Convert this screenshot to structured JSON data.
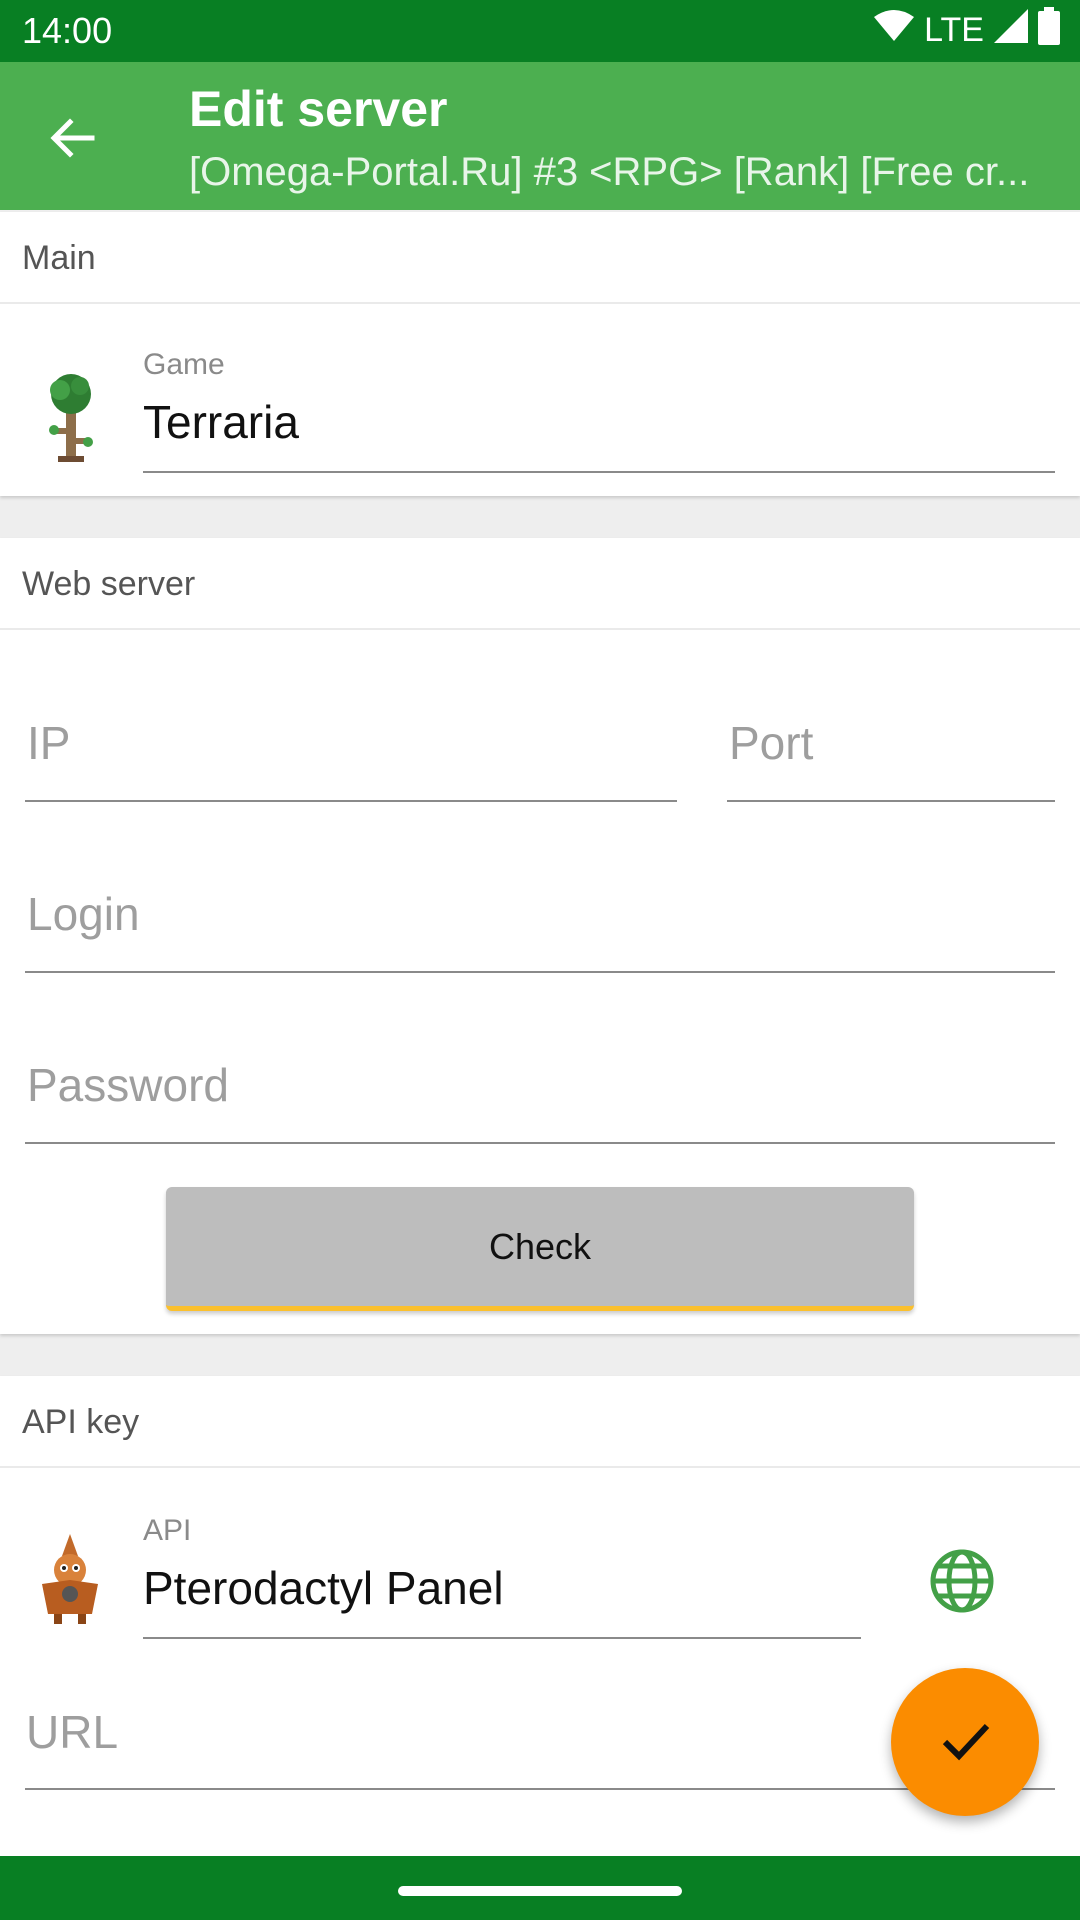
{
  "status_bar": {
    "time": "14:00",
    "network": "LTE",
    "icons": [
      "wifi-icon",
      "signal-icon",
      "battery-icon"
    ]
  },
  "app_bar": {
    "title": "Edit server",
    "subtitle": "[Omega-Portal.Ru] #3 <RPG> [Rank] [Free cr...",
    "back_icon": "arrow-back-icon"
  },
  "sections": {
    "main": {
      "header": "Main",
      "game_label": "Game",
      "game_value": "Terraria",
      "game_icon": "terraria-tree-icon"
    },
    "web_server": {
      "header": "Web server",
      "ip_placeholder": "IP",
      "port_placeholder": "Port",
      "login_placeholder": "Login",
      "password_placeholder": "Password",
      "check_label": "Check"
    },
    "api_key": {
      "header": "API key",
      "api_label": "API",
      "api_value": "Pterodactyl Panel",
      "api_icon": "pterodactyl-icon",
      "globe_icon": "globe-icon",
      "url_placeholder": "URL"
    }
  },
  "fab": {
    "icon": "check-icon"
  },
  "colors": {
    "status_bar": "#087f23",
    "app_bar": "#4caf50",
    "fab": "#fb8c00",
    "accent_underline": "#fbc02d",
    "globe": "#43a047"
  }
}
